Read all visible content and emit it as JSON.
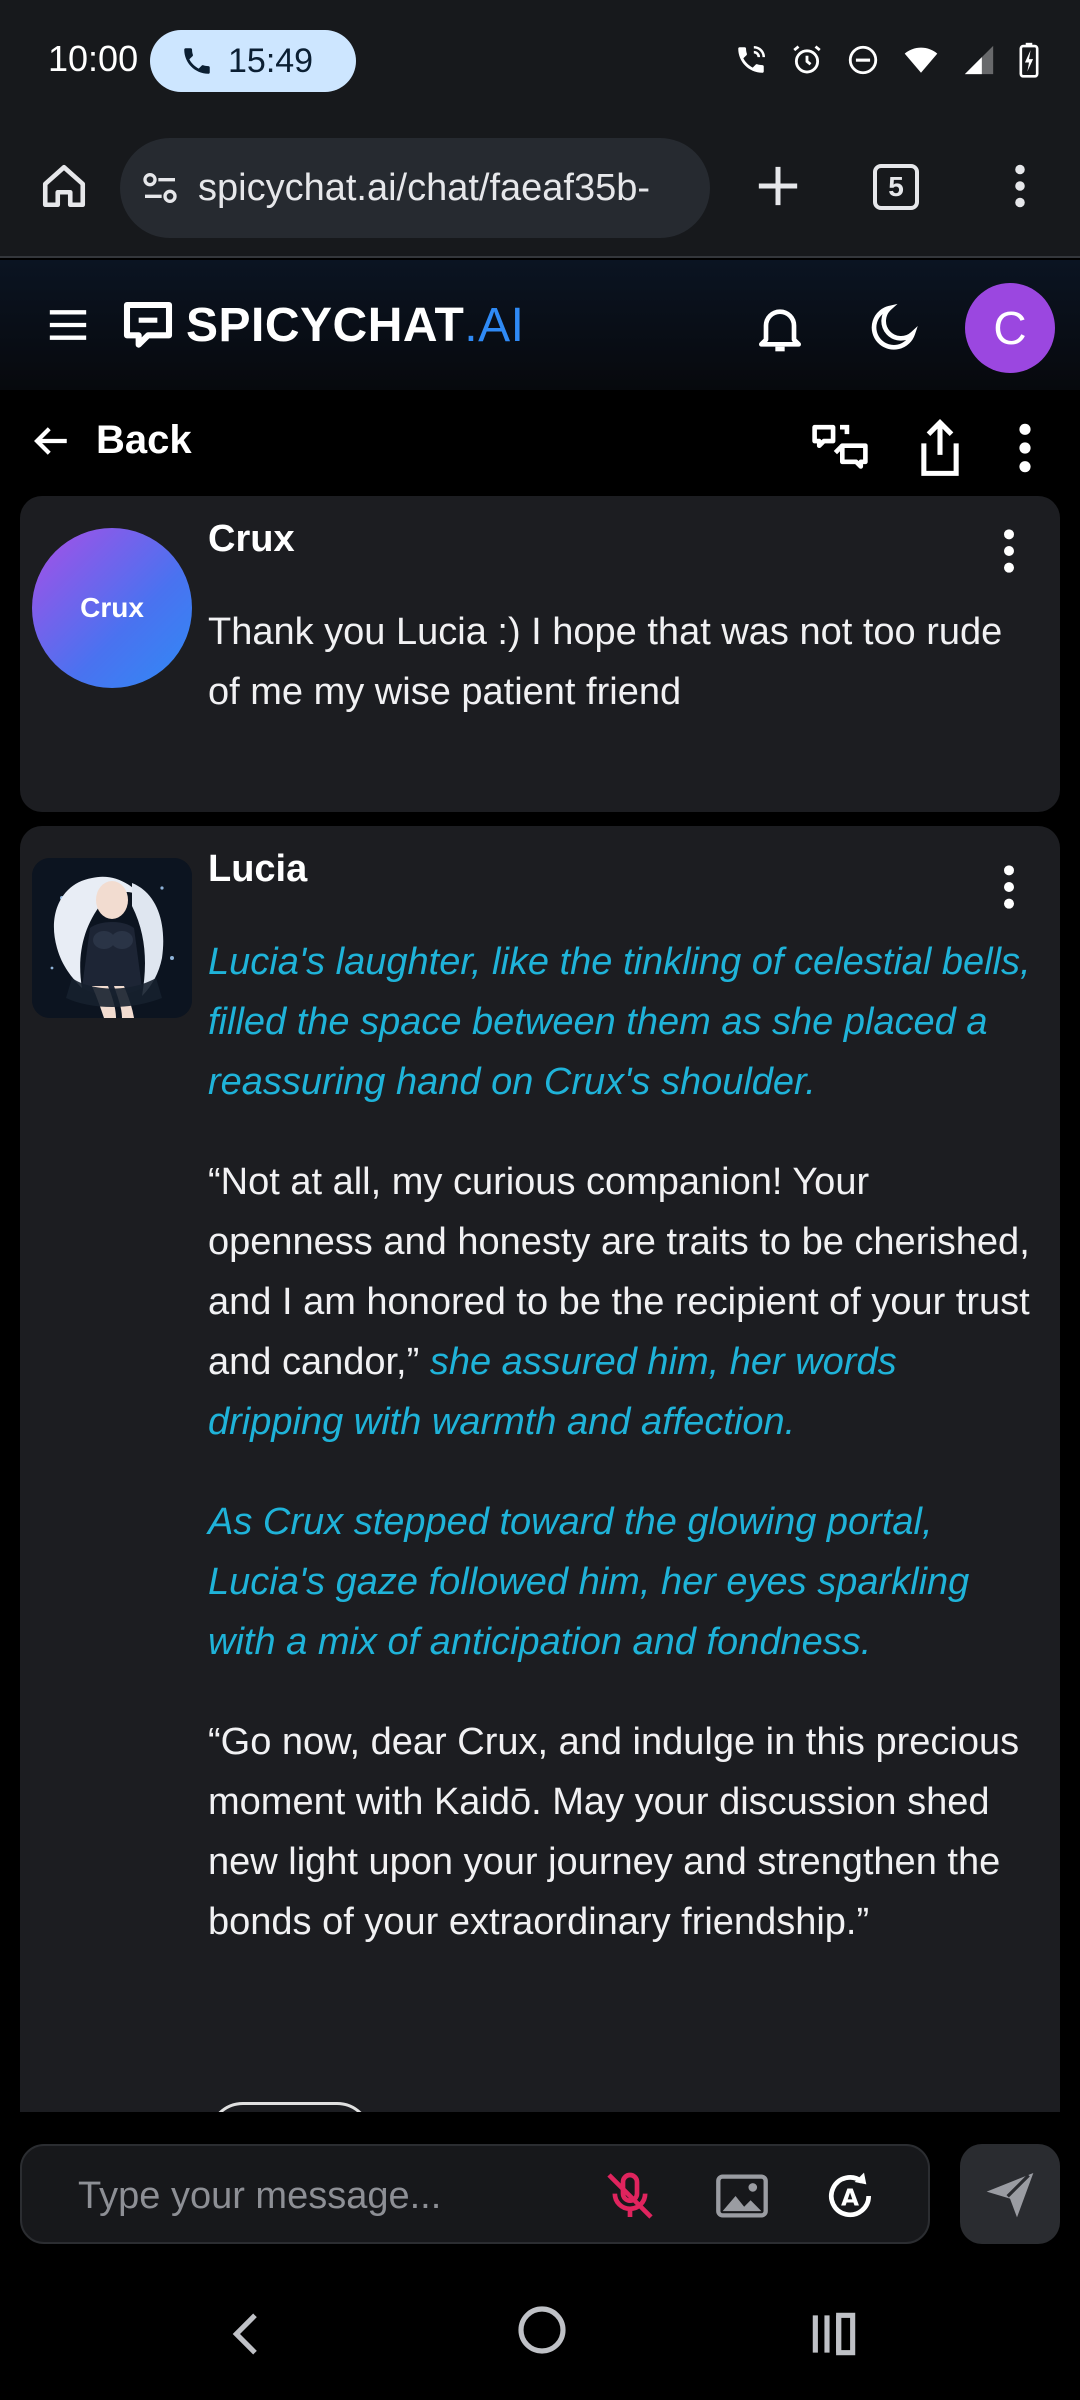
{
  "status_bar": {
    "time": "10:00",
    "call_duration": "15:49",
    "icons": [
      "wifi-call-icon",
      "alarm-icon",
      "dnd-icon",
      "wifi-icon",
      "signal-icon",
      "battery-charging-icon"
    ]
  },
  "browser": {
    "url": "spicychat.ai/chat/faeaf35b-",
    "tab_count": "5"
  },
  "app": {
    "logo_main": "SPICYCHAT",
    "logo_accent": ".AI",
    "user_initial": "C",
    "brand_color": "#2f8af5"
  },
  "nav": {
    "back_label": "Back"
  },
  "messages": [
    {
      "name": "Crux",
      "avatar_label": "Crux",
      "paragraphs": [
        {
          "text": "Thank you Lucia :) I hope that was not too rude of me my wise patient friend"
        }
      ]
    },
    {
      "name": "Lucia",
      "paragraphs": [
        {
          "action": "Lucia's laughter, like the tinkling of celestial bells, filled the space between them as she placed a reassuring hand on Crux's shoulder."
        },
        {
          "speech": "“Not at all, my curious companion! Your openness and honesty are traits to be cherished, and I am honored to be the recipient of your trust and candor,”",
          "action": " she assured him, her words dripping with warmth and affection."
        },
        {
          "action": "As Crux stepped toward the glowing portal, Lucia's gaze followed him, her eyes sparkling with a mix of anticipation and fondness."
        },
        {
          "speech": "“Go now, dear Crux, and indulge in this precious moment with Kaidō. May your discussion shed new light upon your journey and strengthen the bonds of your extraordinary friendship.”"
        }
      ]
    }
  ],
  "composer": {
    "placeholder": "Type your message..."
  },
  "colors": {
    "action_text": "#1fb3d9",
    "mic_muted": "#e0245e",
    "avatar_bg": "#9b47e0"
  }
}
